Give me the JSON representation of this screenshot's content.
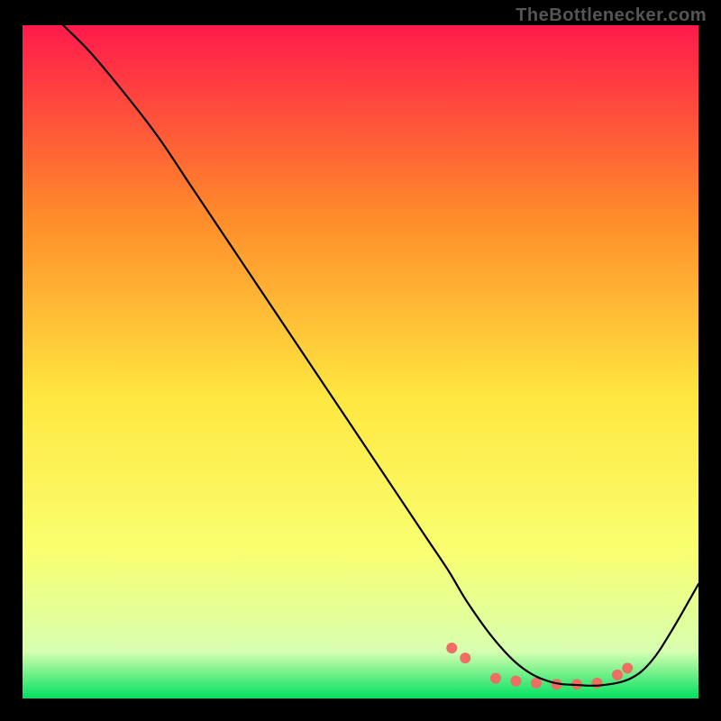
{
  "watermark": "TheBottlenecker.com",
  "chart_data": {
    "type": "line",
    "title": "",
    "xlabel": "",
    "ylabel": "",
    "xlim": [
      0,
      100
    ],
    "ylim": [
      0,
      100
    ],
    "grid": false,
    "background_gradient": {
      "top": "#ff1a4b",
      "mid_upper": "#ff8a2a",
      "mid": "#ffe740",
      "mid_lower": "#f9ff70",
      "near_bottom": "#d8ffb0",
      "bottom": "#00e060"
    },
    "series": [
      {
        "name": "curve",
        "color": "#000000",
        "x": [
          6,
          10,
          15,
          20,
          25,
          30,
          35,
          40,
          45,
          50,
          55,
          60,
          63,
          66,
          70,
          74,
          78,
          82,
          86,
          90,
          93,
          96,
          100
        ],
        "values": [
          100,
          96,
          90,
          83.5,
          76,
          68.5,
          61,
          53.5,
          46,
          38.5,
          31,
          23.5,
          19,
          14,
          8.5,
          4.5,
          2.5,
          2,
          2,
          3,
          5.5,
          10,
          17
        ]
      }
    ],
    "markers": {
      "name": "highlight-dots",
      "color": "#ee6e64",
      "radius": 6,
      "x": [
        63.5,
        65.5,
        70,
        73,
        76,
        79,
        82,
        85,
        88,
        89.5
      ],
      "values": [
        7.5,
        6.0,
        3.0,
        2.6,
        2.3,
        2.1,
        2.1,
        2.3,
        3.5,
        4.5
      ]
    }
  }
}
